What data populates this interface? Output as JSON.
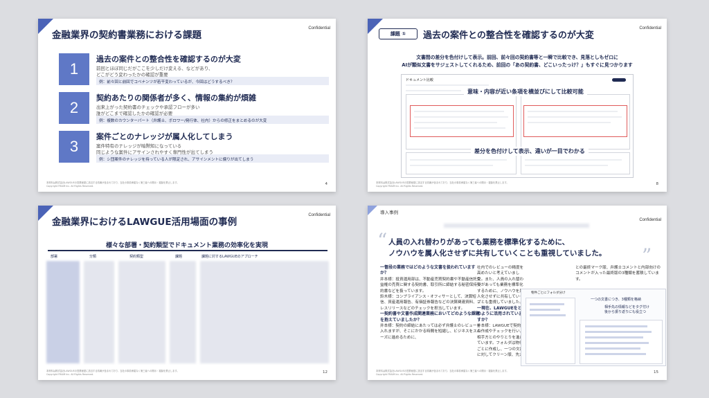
{
  "confidential": "Confidential",
  "footer_lines": [
    "本資料は株式会社LAWGUEの営業秘密に該当する情報が含まれており、当社の事前承諾なく第三者への開示・複製を禁止します。",
    "Copyright FRAIM Inc. All Rights Reserved."
  ],
  "slide1": {
    "title": "金融業界の契約書業務における課題",
    "page": "4",
    "issues": [
      {
        "num": "1",
        "head": "過去の案件との整合性を確認するのが大変",
        "l1": "前回とほぼ同じだがここを少しだけ変える、などがあり、",
        "l2": "どこがどう変わったかの確認が重要",
        "ex": "例：前々回と前回でコベナンツが若干変わっているが、今回はどうするべき？"
      },
      {
        "num": "2",
        "head": "契約あたりの関係者が多く、情報の集約が煩雑",
        "l1": "出来上がった契約書のチェックや承認フローが多い",
        "l2": "誰がどこまで確認したかの確認が必要",
        "ex": "例：複数のカウンターパート（弁護士、ボロワー/発行体、社内）からの修正をまとめるのが大変"
      },
      {
        "num": "3",
        "head": "案件ごとのナレッジが属人化してしまう",
        "l1": "案件特有のナレッジが暗黙知になっている",
        "l2": "同じような案件にアサインされやすく専門性が出てしまう",
        "ex": "例：シ団案件のナレッジを持っている人が限定され、アサインメントに偏りが出てしまう"
      }
    ]
  },
  "slide2": {
    "badge": "課題 ①",
    "title": "過去の案件との整合性を確認するのが大変",
    "desc1": "文書間の差分を色付けして表示。前回、前々回の契約書等と一瞬で比較でき、見落としもゼロに",
    "desc2": "AIが類似文書をサジェストしてくれるため、前回の「あの契約書、どこいったっけ？」もすぐに見つかります",
    "window_title": "ドキュメント比較",
    "callout1": "意味・内容が近い条項を横並びにして比較可能",
    "callout2": "差分を色付けして表示、違いが一目でわかる",
    "page": "8"
  },
  "slide3": {
    "title": "金融業界におけるLAWGUE活用場面の事例",
    "subhead": "様々な部署・契約類型でドキュメント業務の効率化を実現",
    "columns": [
      "部署",
      "分類",
      "契約類型",
      "課題",
      "課題に対するLAWGUEのアプローチ"
    ],
    "page": "12"
  },
  "slide4": {
    "section": "導入事例",
    "quote1": "人員の入れ替わりがあっても業務を標準化するために、",
    "quote2": "ノウハウを属人化させずに共有していくことも重視していました。",
    "col1": [
      {
        "type": "q",
        "text": "一督段の業務ではどのような文書を扱われていますか？"
      },
      {
        "type": "a",
        "text": "井本様：投資運用部は、不動産売買契約書や不動産信託受益権の売買に関する契約書、取引所に締結する秘密保持契約書などを扱っています。"
      },
      {
        "type": "a",
        "text": "鈴木様：コンプライアンス・オフィサーとして、決算短信、資産運用報告、有価証券報告などの決算関連資料、プレスリリースなどのチェックを担当しています。"
      },
      {
        "type": "q",
        "text": "一契約書や文書作成関連業務においてどのような課題を抱えていましたか？"
      },
      {
        "type": "a",
        "text": "井本様：契約の締結にあたっては必ず弁護士のレビューを入れますが、そこにかかる時間を短縮し、ビジネスをスムーズに進めるために、"
      }
    ],
    "col2": [
      {
        "type": "a",
        "text": "社内でのレビューの精度を高めたいと考えていました。また、人員の入れ替わりがあっても業務を標準化するために、ノウハウを属人化させずに共有していくことも重視していました。"
      },
      {
        "type": "q",
        "text": "一現在、LAWGUEをどのように活用されていますか？"
      },
      {
        "type": "a",
        "text": "井本様：LAWGUEで契約書の作成やチェックを行い、相手方とのやりとりを進めています。フォルダは物件ごとに作成し、一つの文書に対してクリーン版、先方"
      }
    ],
    "col3": "との最終マーク版、弁護士コメントと内部向けのコメントが入った最終版の3種類を蓄積しています。",
    "diagram_tab": "物件ごとにフォルダ分け",
    "diagram_note1": "一つの文書につき、3種類を格納",
    "diagram_note2": "相手先の情報などをタグ付け",
    "diagram_note3": "後から振り返りにも役立つ",
    "page": "15"
  }
}
